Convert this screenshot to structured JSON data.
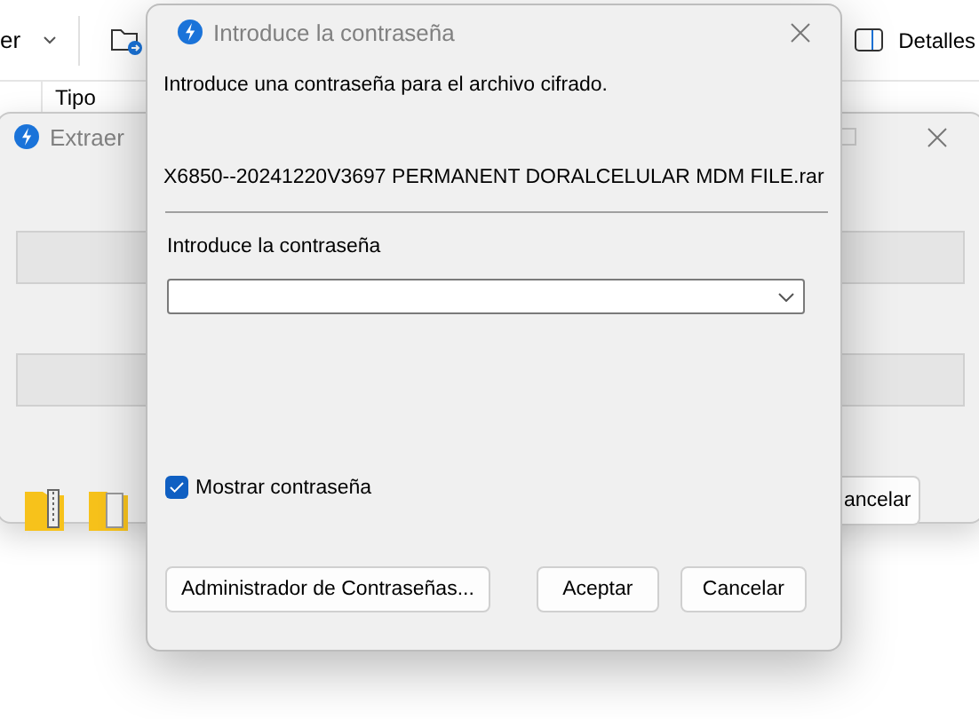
{
  "explorer": {
    "view_button": "er",
    "details_button": "Detalles",
    "column_header": "Tipo"
  },
  "extract_window": {
    "title": "Extraer",
    "cancel_button": "ancelar"
  },
  "dialog": {
    "title": "Introduce la contraseña",
    "message": "Introduce una contraseña para el archivo cifrado.",
    "filename": "X6850--20241220V3697 PERMANENT DORALCELULAR MDM FILE.rar",
    "password_label": "Introduce la contraseña",
    "show_password": {
      "label": "Mostrar contraseña",
      "checked": true
    },
    "buttons": [
      {
        "label": "Administrador de Contraseñas..."
      },
      {
        "label": "Aceptar"
      },
      {
        "label": "Cancelar"
      }
    ]
  }
}
